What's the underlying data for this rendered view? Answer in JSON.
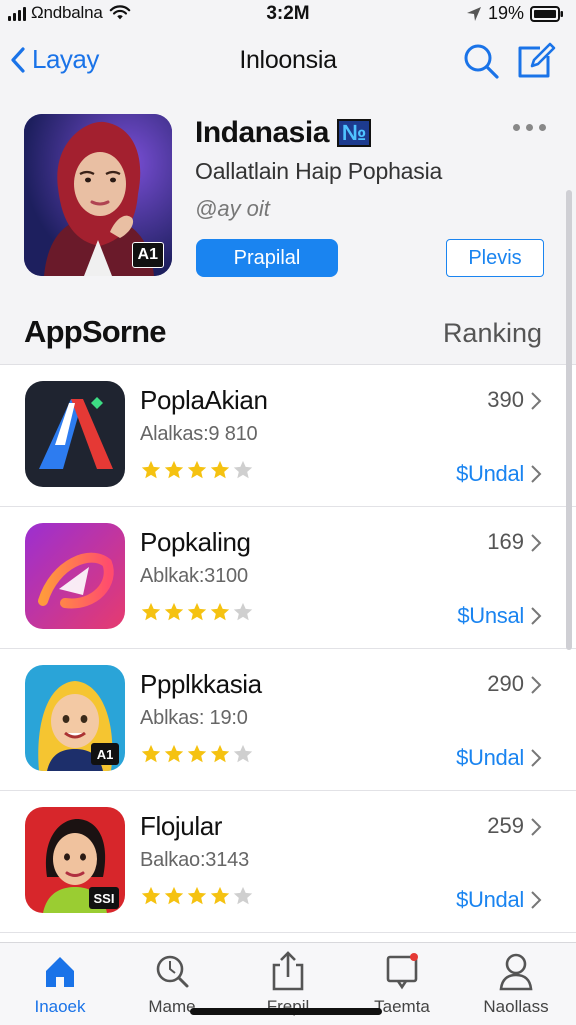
{
  "status_bar": {
    "carrier": "Ωndbalna",
    "time": "3:2M",
    "battery": "19%"
  },
  "nav": {
    "back_label": "Layay",
    "title": "Inloonsia"
  },
  "featured": {
    "title": "Indanasia",
    "title_mark": "№",
    "subtitle": "Oallatlain Haip Pophasia",
    "meta": "@ay oit",
    "badge": "A1",
    "primary_button": "Prapilal",
    "secondary_button": "Plevis"
  },
  "section": {
    "title": "AppSorne",
    "link": "Ranking"
  },
  "apps": [
    {
      "name": "PoplaAkian",
      "sub": "Alalkas:9 810",
      "rank": "390",
      "price": "$Undal",
      "rating": 4
    },
    {
      "name": "Popkaling",
      "sub": "Ablkak:3100",
      "rank": "169",
      "price": "$Unsal",
      "rating": 4
    },
    {
      "name": "Ppplkkasia",
      "sub": "Ablkas: 19:0",
      "rank": "290",
      "price": "$Undal",
      "rating": 4
    },
    {
      "name": "Flojular",
      "sub": "Balkao:3143",
      "rank": "259",
      "price": "$Undal",
      "rating": 4
    }
  ],
  "app_icon_badges": [
    "A1",
    "SSI"
  ],
  "tabs": [
    {
      "label": "Inaoek",
      "icon": "home-icon"
    },
    {
      "label": "Mame",
      "icon": "search-icon"
    },
    {
      "label": "Frepil",
      "icon": "share-icon"
    },
    {
      "label": "Taemta",
      "icon": "notifications-icon"
    },
    {
      "label": "Naollass",
      "icon": "profile-icon"
    }
  ],
  "colors": {
    "accent": "#1a84f0",
    "star": "#f5c211",
    "star_empty": "#cfcfcf"
  }
}
